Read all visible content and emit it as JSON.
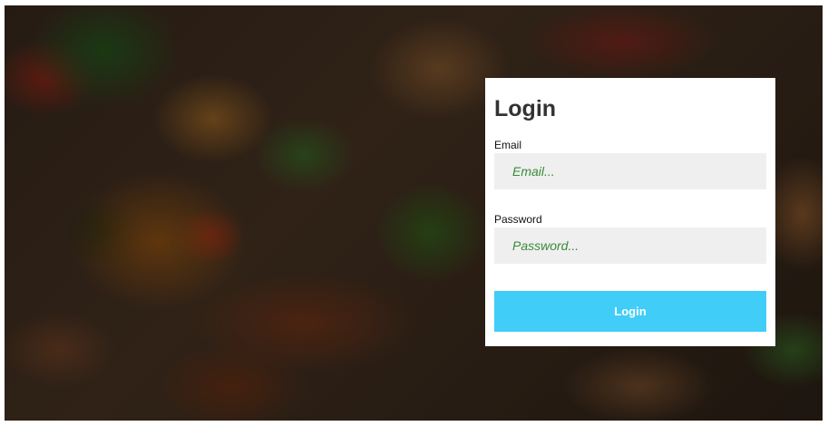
{
  "login": {
    "title": "Login",
    "email_label": "Email",
    "email_placeholder": "Email...",
    "email_value": "",
    "password_label": "Password",
    "password_placeholder": "Password...",
    "password_value": "",
    "submit_label": "Login"
  },
  "colors": {
    "button_bg": "#40cdf7",
    "input_bg": "#efefef",
    "placeholder_text": "#3a8a3a",
    "card_bg": "#ffffff"
  }
}
